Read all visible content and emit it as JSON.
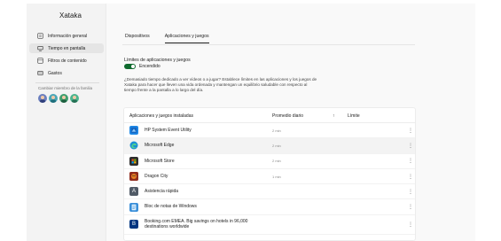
{
  "app": {
    "title": "Xataka"
  },
  "sidebar": {
    "items": [
      {
        "label": "Información general",
        "icon": "info-icon",
        "active": false
      },
      {
        "label": "Tiempo en pantalla",
        "icon": "screen-time-icon",
        "active": true
      },
      {
        "label": "Filtros de contenido",
        "icon": "content-filter-icon",
        "active": false
      },
      {
        "label": "Gastos",
        "icon": "spending-icon",
        "active": false
      }
    ],
    "family_label": "Cambiar miembro de la familia",
    "avatars": [
      {
        "name": "avatar-1",
        "color": "#6b7fbf"
      },
      {
        "name": "avatar-2",
        "color": "#4aa7b8"
      },
      {
        "name": "avatar-3",
        "color": "#3f9f6e"
      },
      {
        "name": "avatar-4",
        "color": "#4bb58e"
      }
    ]
  },
  "tabs": [
    {
      "label": "Dispositivos",
      "active": false
    },
    {
      "label": "Aplicaciones y juegos",
      "active": true
    }
  ],
  "limits": {
    "title": "Límites de aplicaciones y juegos",
    "toggle_label": "Encendido",
    "toggle_on": true,
    "description": "¿Demasiado tiempo dedicado a ver vídeos o a jugar? Establece límites en las aplicaciones y los juegos de Xataka para hacer que lleven una vida ordenada y mantengan un equilibrio saludable con respecto al tiempo frente a la pantalla a lo largo del día."
  },
  "table": {
    "columns": {
      "app": "Aplicaciones y juegos instaladas",
      "avg": "Promedio diario",
      "limit": "Límite"
    },
    "rows": [
      {
        "name": "HP System Event Utility",
        "avg": "2 min",
        "icon": "hp-app-icon",
        "color": "#1e88e5",
        "glyph": ""
      },
      {
        "name": "Microsoft Edge",
        "avg": "2 min",
        "icon": "edge-icon",
        "color": "#1a8fd6",
        "glyph": "e",
        "hover": true
      },
      {
        "name": "Microsoft Store",
        "avg": "2 min",
        "icon": "store-icon",
        "color": "#2d2d2d",
        "glyph": ""
      },
      {
        "name": "Dragon City",
        "avg": "1 min",
        "icon": "dragon-city-icon",
        "color": "#c0392b",
        "glyph": ""
      },
      {
        "name": "Asistencia rápida",
        "avg": "",
        "icon": "quick-assist-icon",
        "color": "#505a66",
        "glyph": "A"
      },
      {
        "name": "Bloc de notas de Windows",
        "avg": "",
        "icon": "notepad-icon",
        "color": "#3a8fd9",
        "glyph": ""
      },
      {
        "name": "Booking.com EMEA. Big savings on hotels in 96,000 destinations worldwide",
        "avg": "",
        "icon": "booking-icon",
        "color": "#003580",
        "glyph": "B"
      }
    ]
  }
}
